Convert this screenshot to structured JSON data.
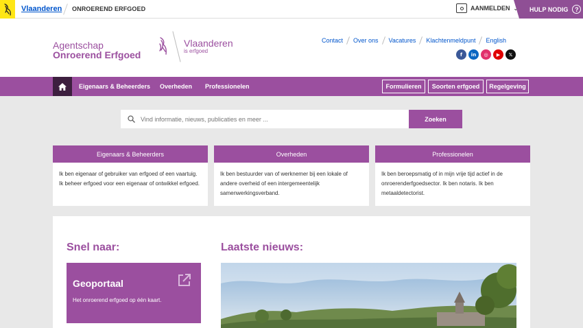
{
  "topbar": {
    "vlaanderen_link": "Vlaanderen",
    "crumb": "ONROEREND ERFGOED",
    "login_label": "AANMELDEN",
    "help_label": "HULP NODIG",
    "help_glyph": "?"
  },
  "header": {
    "org_line1": "Agentschap",
    "org_line2": "Onroerend Erfgoed",
    "brand_name": "Vlaanderen",
    "brand_sub": "is erfgoed",
    "util_links": [
      "Contact",
      "Over ons",
      "Vacatures",
      "Klachtenmeldpunt",
      "English"
    ],
    "socials": [
      {
        "icon": "facebook-icon",
        "glyph": "f",
        "color": "#3b5998"
      },
      {
        "icon": "linkedin-icon",
        "glyph": "in",
        "color": "#0a66c2"
      },
      {
        "icon": "instagram-icon",
        "glyph": "◎",
        "color": "#e1306c"
      },
      {
        "icon": "youtube-icon",
        "glyph": "▶",
        "color": "#e00000"
      },
      {
        "icon": "x-icon",
        "glyph": "𝕏",
        "color": "#111111"
      }
    ]
  },
  "nav": {
    "items": [
      "Eigenaars & Beheerders",
      "Overheden",
      "Professionelen"
    ],
    "boxes": [
      "Formulieren",
      "Soorten erfgoed",
      "Regelgeving"
    ]
  },
  "search": {
    "placeholder": "Vind informatie, nieuws, publicaties en meer ...",
    "button": "Zoeken"
  },
  "cards": [
    {
      "title": "Eigenaars & Beheerders",
      "text": "Ik ben eigenaar of gebruiker van erfgoed of een vaartuig. Ik beheer erfgoed voor een eigenaar of ontwikkel erfgoed."
    },
    {
      "title": "Overheden",
      "text": "Ik ben bestuurder van of werknemer bij een lokale of andere overheid of een intergemeentelijk samenwerkingsverband."
    },
    {
      "title": "Professionelen",
      "text": "Ik ben beroepsmatig of in mijn vrije tijd actief in de onroerenderfgoedsector. Ik ben notaris. Ik ben metaaldetectorist."
    }
  ],
  "snel": {
    "title": "Snel naar:",
    "tile_name": "Geoportaal",
    "tile_desc": "Het onroerend erfgoed op één kaart."
  },
  "news": {
    "title": "Laatste nieuws:"
  }
}
